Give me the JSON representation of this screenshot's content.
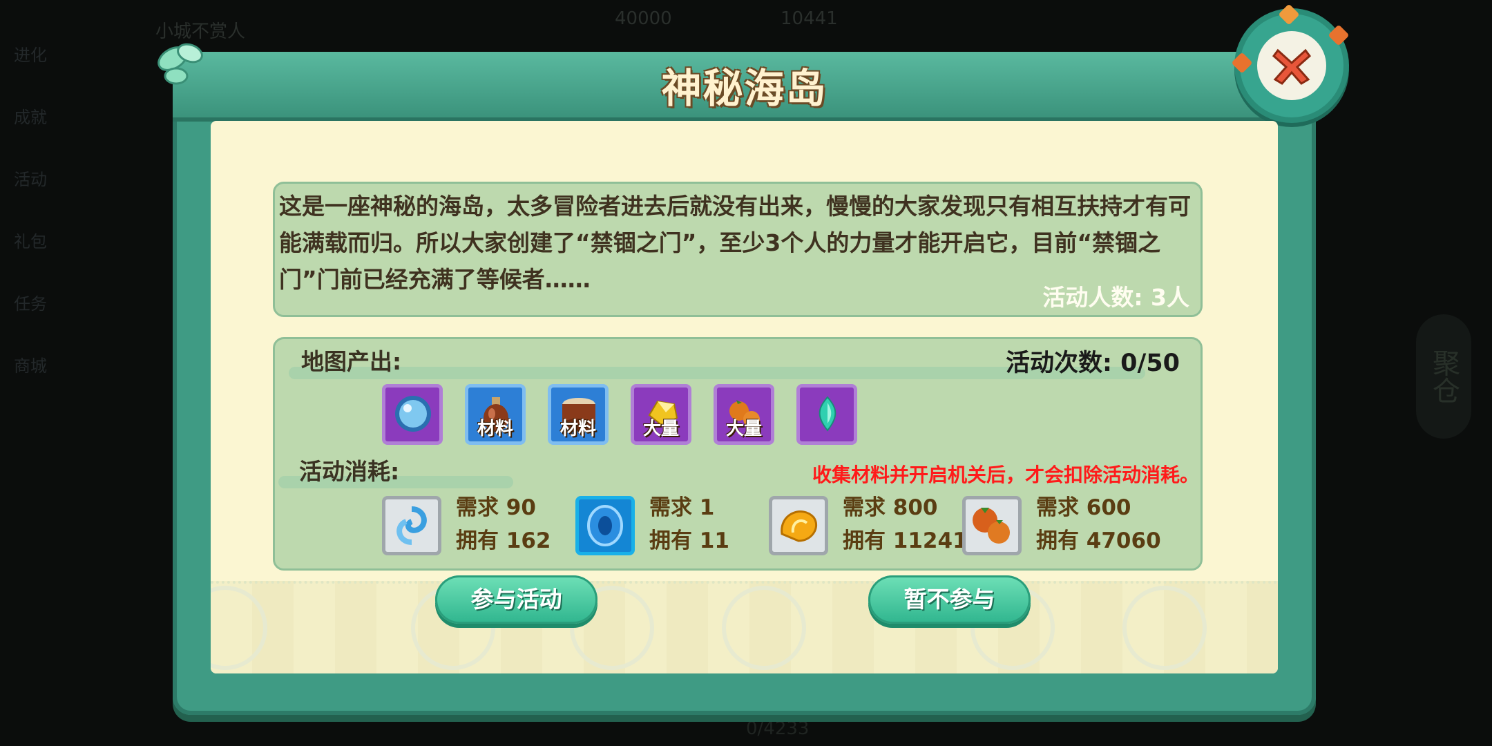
{
  "dialog": {
    "title": "神秘海岛",
    "description": "这是一座神秘的海岛，太多冒险者进去后就没有出来，慢慢的大家发现只有相互扶持才有可能满载而归。所以大家创建了“禁锢之门”，至少3个人的力量才能开启它，目前“禁锢之门”门前已经充满了等候者……",
    "participants": "活动人数: 3人"
  },
  "map_output": {
    "label": "地图产出:",
    "count_label": "活动次数: 0/50",
    "items": [
      {
        "icon": "blue-orb-icon",
        "tag": ""
      },
      {
        "icon": "potion-bottle-icon",
        "tag": "材料"
      },
      {
        "icon": "drum-icon",
        "tag": "材料"
      },
      {
        "icon": "gold-ingot-icon",
        "tag": "大量"
      },
      {
        "icon": "fruit-icon",
        "tag": "大量"
      },
      {
        "icon": "teal-crystal-icon",
        "tag": ""
      }
    ]
  },
  "cost": {
    "label": "活动消耗:",
    "warning": "收集材料并开启机关后，才会扣除活动消耗。",
    "items": [
      {
        "icon": "swirl-icon",
        "need": "需求 90",
        "have": "拥有 162"
      },
      {
        "icon": "blue-stone-icon",
        "need": "需求 1",
        "have": "拥有 11"
      },
      {
        "icon": "shell-coin-icon",
        "need": "需求 800",
        "have": "拥有 11241"
      },
      {
        "icon": "strawberry-icon",
        "need": "需求 600",
        "have": "拥有 47060"
      }
    ]
  },
  "buttons": {
    "join": "参与活动",
    "decline": "暂不参与"
  },
  "background": {
    "left_menu": [
      "进化",
      "成就",
      "活动",
      "礼包",
      "任务",
      "商城"
    ],
    "top_name": "小城不赏人",
    "top_value1": "40000",
    "top_value2": "10441",
    "right_label": "聚仓",
    "bottom_text": "0/4233"
  },
  "colors": {
    "frame": "#3f9b84",
    "panel": "#fbf6d2",
    "box": "#bdd9ae",
    "warning": "#ff1a1a",
    "button": "#2fb58e"
  }
}
